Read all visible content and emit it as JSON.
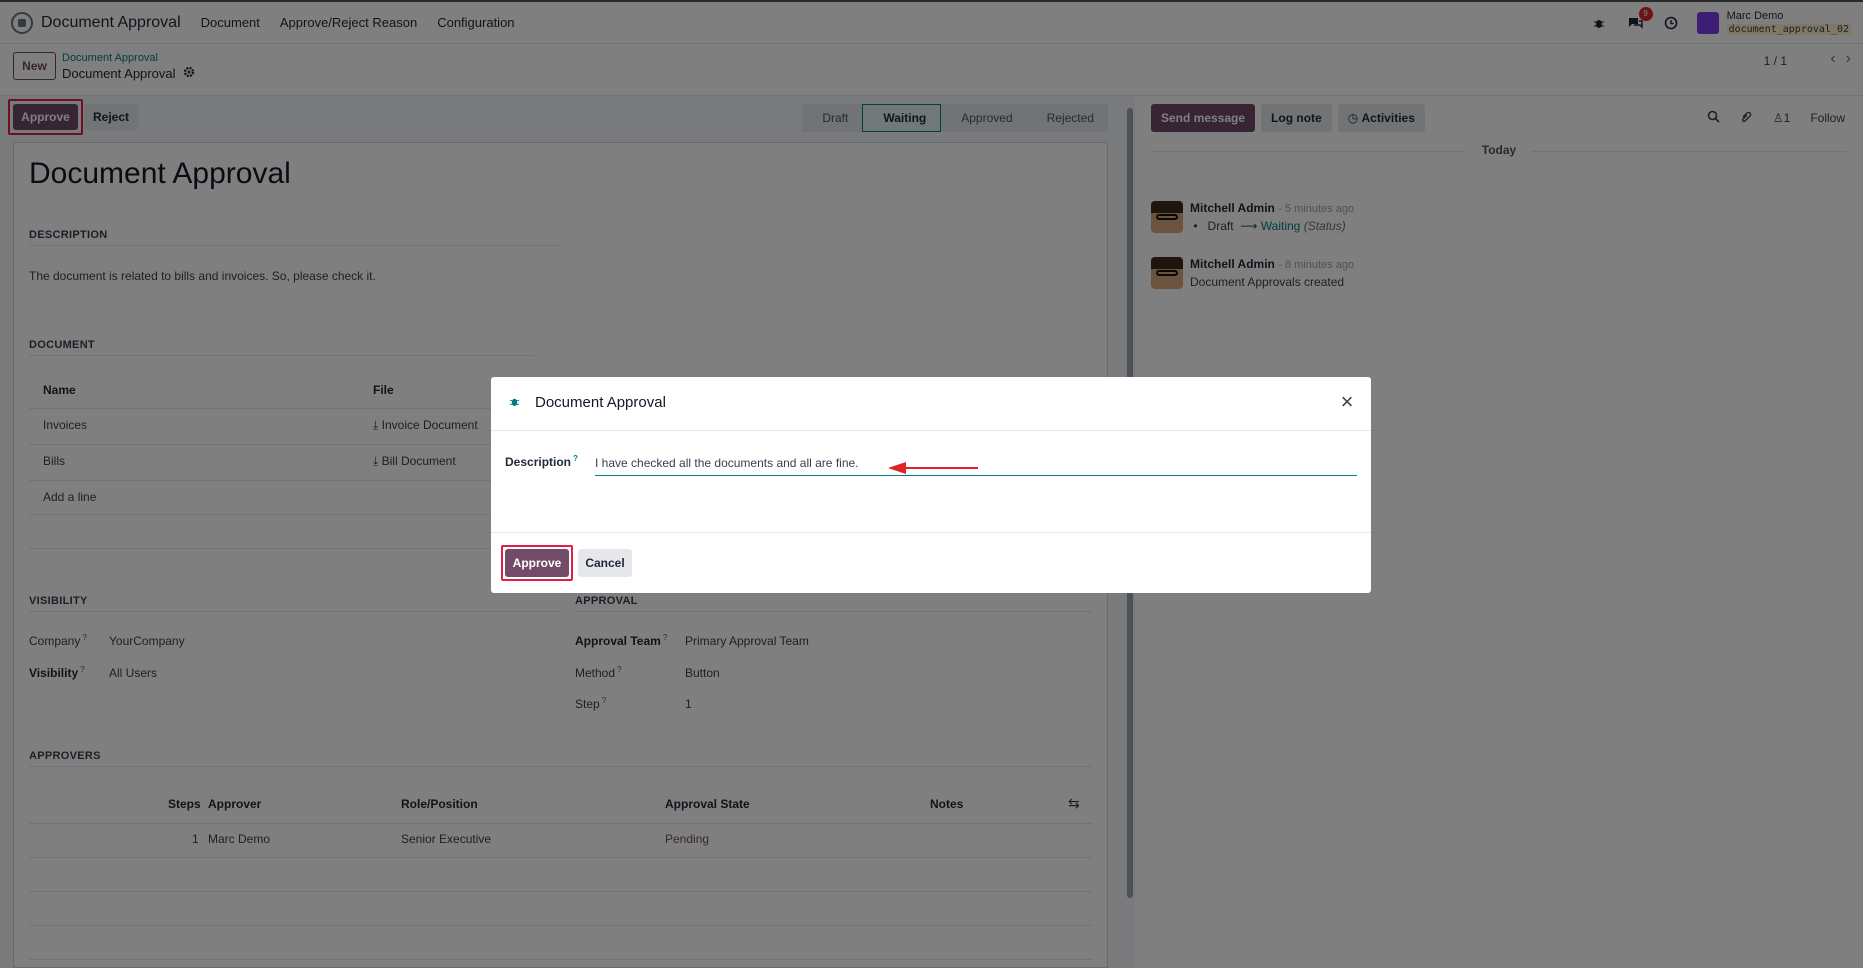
{
  "navbar": {
    "app_name": "Document Approval",
    "menu": [
      "Document",
      "Approve/Reject Reason",
      "Configuration"
    ],
    "chat_badge": "9",
    "user_name": "Marc Demo",
    "db_name": "document_approval_02"
  },
  "control_panel": {
    "new_label": "New",
    "breadcrumb_parent": "Document Approval",
    "breadcrumb_current": "Document Approval",
    "pager": "1 / 1"
  },
  "statusbar": {
    "approve_label": "Approve",
    "reject_label": "Reject",
    "stages": [
      "Draft",
      "Waiting",
      "Approved",
      "Rejected"
    ],
    "active_stage": "Waiting"
  },
  "form": {
    "title": "Document Approval",
    "description_head": "DESCRIPTION",
    "description_text": "The document is related to bills and invoices. So, please check it.",
    "document_head": "DOCUMENT",
    "doc_columns": [
      "Name",
      "File"
    ],
    "doc_rows": [
      {
        "name": "Invoices",
        "file": "Invoice Document"
      },
      {
        "name": "Bills",
        "file": "Bill Document"
      }
    ],
    "add_line": "Add a line",
    "visibility_head": "VISIBILITY",
    "company_label": "Company",
    "company_value": "YourCompany",
    "visibility_label": "Visibility",
    "visibility_value": "All Users",
    "approval_head": "APPROVAL",
    "approval_team_label": "Approval Team",
    "approval_team_value": "Primary Approval Team",
    "method_label": "Method",
    "method_value": "Button",
    "step_label": "Step",
    "step_value": "1",
    "approvers_head": "APPROVERS",
    "approver_columns": [
      "Steps",
      "Approver",
      "Role/Position",
      "Approval State",
      "Notes"
    ],
    "approver_rows": [
      {
        "steps": "1",
        "approver": "Marc Demo",
        "role": "Senior Executive",
        "state": "Pending"
      }
    ]
  },
  "chatter": {
    "send_message": "Send message",
    "log_note": "Log note",
    "activities": "Activities",
    "followers_count": "1",
    "follow": "Follow",
    "today": "Today",
    "messages": [
      {
        "author": "Mitchell Admin",
        "time": "- 5 minutes ago",
        "from": "Draft",
        "to": "Waiting",
        "field": "(Status)"
      },
      {
        "author": "Mitchell Admin",
        "time": "- 8 minutes ago",
        "body": "Document Approvals created"
      }
    ]
  },
  "modal": {
    "title": "Document Approval",
    "description_label": "Description",
    "description_value": "I have checked all the documents and all are fine.",
    "approve_label": "Approve",
    "cancel_label": "Cancel"
  },
  "colors": {
    "primary": "#714b67",
    "link": "#017e84",
    "highlight": "#e11d48"
  }
}
